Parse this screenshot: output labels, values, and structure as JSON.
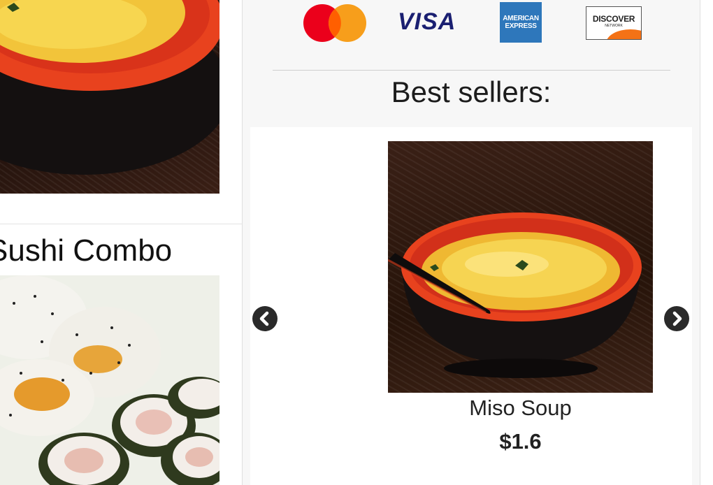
{
  "left": {
    "product_title": "Sushi Combo"
  },
  "payments": {
    "icons": [
      "mastercard-icon",
      "visa-icon",
      "amex-icon",
      "discover-icon"
    ],
    "visa_text": "VISA",
    "amex_text_1": "AMERICAN",
    "amex_text_2": "EXPRESS",
    "discover_text": "DISCOVER",
    "discover_sub": "NETWORK"
  },
  "best_sellers": {
    "heading": "Best sellers:",
    "current_item": {
      "name": "Miso Soup",
      "price": "$1.6"
    }
  },
  "colors": {
    "mastercard_red": "#eb001b",
    "mastercard_orange": "#f79e1b",
    "visa_blue": "#1a1f71",
    "amex_blue": "#2e77bb",
    "discover_orange": "#f47216"
  }
}
